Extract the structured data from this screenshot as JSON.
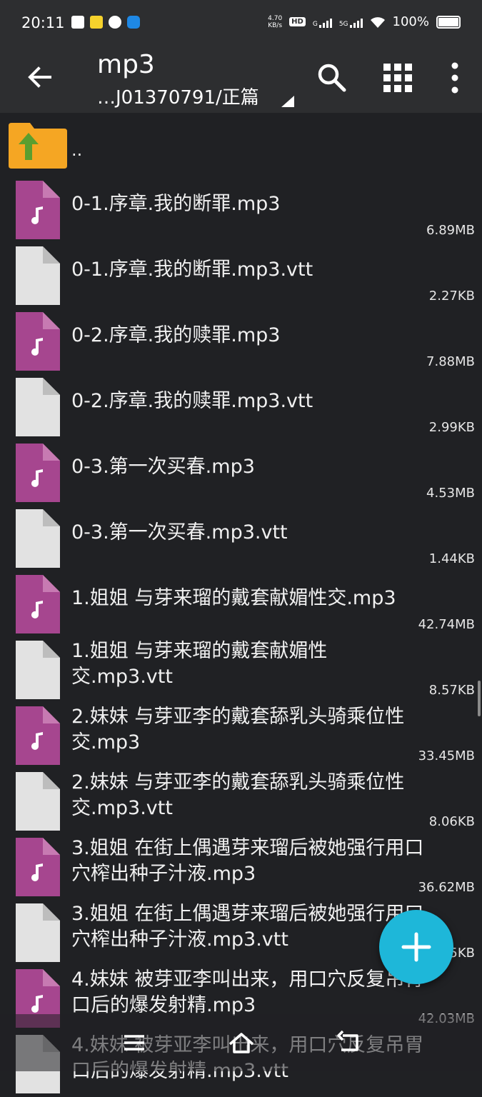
{
  "status_bar": {
    "time": "20:11",
    "net_speed_top": "4.70",
    "net_speed_bottom": "KB/s",
    "hd": "HD",
    "sim1": "G",
    "sim2": "5G",
    "battery": "100%"
  },
  "toolbar": {
    "title": "mp3",
    "path": "…J01370791/正篇"
  },
  "list": {
    "parent_label": "..",
    "files": [
      {
        "name": "0-1.序章.我的断罪.mp3",
        "size": "6.89MB",
        "type": "audio"
      },
      {
        "name": "0-1.序章.我的断罪.mp3.vtt",
        "size": "2.27KB",
        "type": "doc"
      },
      {
        "name": "0-2.序章.我的赎罪.mp3",
        "size": "7.88MB",
        "type": "audio"
      },
      {
        "name": "0-2.序章.我的赎罪.mp3.vtt",
        "size": "2.99KB",
        "type": "doc"
      },
      {
        "name": "0-3.第一次买春.mp3",
        "size": "4.53MB",
        "type": "audio"
      },
      {
        "name": "0-3.第一次买春.mp3.vtt",
        "size": "1.44KB",
        "type": "doc"
      },
      {
        "name": "1.姐姐 与芽来瑠的戴套献媚性交.mp3",
        "size": "42.74MB",
        "type": "audio"
      },
      {
        "name": "1.姐姐 与芽来瑠的戴套献媚性交.mp3.vtt",
        "size": "8.57KB",
        "type": "doc"
      },
      {
        "name": "2.妹妹 与芽亚李的戴套舔乳头骑乘位性交.mp3",
        "size": "33.45MB",
        "type": "audio"
      },
      {
        "name": "2.妹妹 与芽亚李的戴套舔乳头骑乘位性交.mp3.vtt",
        "size": "8.06KB",
        "type": "doc"
      },
      {
        "name": "3.姐姐 在街上偶遇芽来瑠后被她强行用口穴榨出种子汁液.mp3",
        "size": "36.62MB",
        "type": "audio"
      },
      {
        "name": "3.姐姐 在街上偶遇芽来瑠后被她强行用口穴榨出种子汁液.mp3.vtt",
        "size": "5KB",
        "type": "doc"
      },
      {
        "name": "4.妹妹 被芽亚李叫出来，用口穴反复吊胃口后的爆发射精.mp3",
        "size": "42.03MB",
        "type": "audio"
      },
      {
        "name": "4.妹妹 被芽亚李叫出来，用口穴反复吊胃口后的爆发射精.mp3.vtt",
        "size": "",
        "type": "doc"
      }
    ]
  },
  "colors": {
    "audio_icon": "#a6468f",
    "doc_icon": "#e2e2e2",
    "fab": "#1eb7d9",
    "folder": "#f5a623",
    "folder_arrow": "#5a9e2f"
  },
  "icons": {
    "back": "arrow-back-icon",
    "search": "search-icon",
    "grid": "grid-view-icon",
    "more": "more-vert-icon",
    "fab": "plus-icon"
  }
}
